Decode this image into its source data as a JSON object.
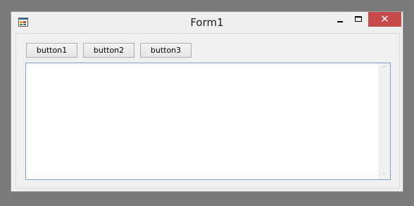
{
  "window": {
    "title": "Form1",
    "controls": {
      "minimize_icon": "minimize-icon",
      "maximize_icon": "maximize-icon",
      "close_symbol": "✕"
    },
    "close_color": "#c74a4a"
  },
  "toolbar": {
    "buttons": [
      {
        "label": "button1"
      },
      {
        "label": "button2"
      },
      {
        "label": "button3"
      }
    ]
  },
  "textbox": {
    "value": "",
    "scroll_up_symbol": "⌃",
    "scroll_down_symbol": "⌄"
  }
}
